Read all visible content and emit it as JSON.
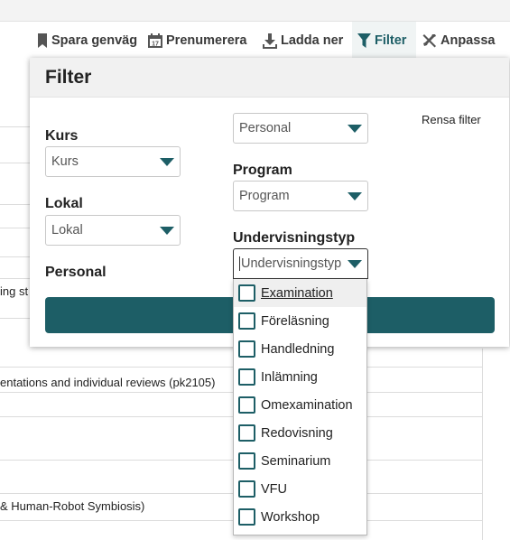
{
  "toolbar": {
    "items": [
      {
        "label": "Spara genväg",
        "icon": "bookmark-icon"
      },
      {
        "label": "Prenumerera",
        "icon": "calendar-icon"
      },
      {
        "label": "Ladda ner",
        "icon": "download-icon"
      },
      {
        "label": "Filter",
        "icon": "filter-icon",
        "active": true
      },
      {
        "label": "Anpassa",
        "icon": "tools-icon"
      }
    ]
  },
  "background": {
    "row_texts": [
      "ing st",
      "entations and individual reviews (pk2105)",
      "& Human-Robot Symbiosis)"
    ]
  },
  "filter": {
    "title": "Filter",
    "clear_label": "Rensa filter",
    "kurs": {
      "label": "Kurs",
      "value": "Kurs"
    },
    "lokal": {
      "label": "Lokal",
      "value": "Lokal"
    },
    "personal": {
      "label": "Personal",
      "value": "Personal"
    },
    "program": {
      "label": "Program",
      "value": "Program"
    },
    "undervisningstyp": {
      "label": "Undervisningstyp",
      "placeholder": "Undervisningstyp",
      "options": [
        "Examination",
        "Föreläsning",
        "Handledning",
        "Inlämning",
        "Omexamination",
        "Redovisning",
        "Seminarium",
        "VFU",
        "Workshop"
      ],
      "highlighted_option": "Examination"
    }
  },
  "colors": {
    "accent": "#1d5e66",
    "panel_header_bg": "#f1f1f1",
    "active_tab_bg": "#f0f4f4"
  }
}
